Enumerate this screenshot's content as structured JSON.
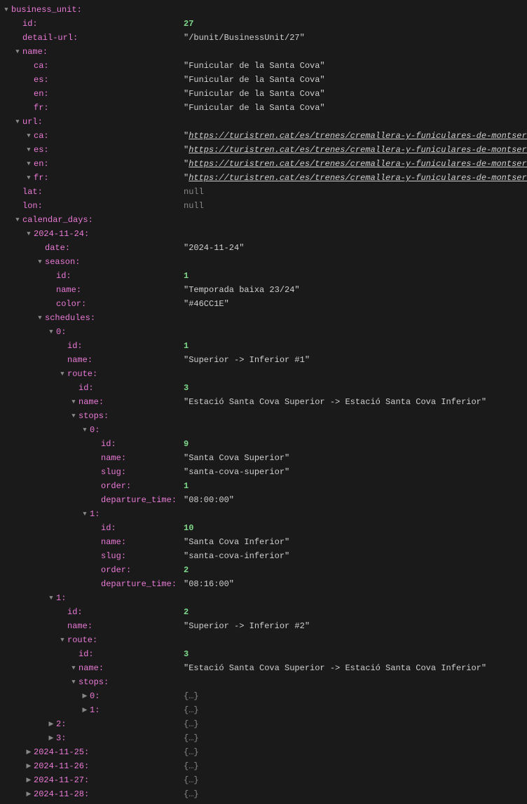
{
  "arrow_expanded": "▼",
  "arrow_collapsed": "▶",
  "collapsed_placeholder": "{…}",
  "rows": [
    {
      "indent": 0,
      "arrow": "expanded",
      "key": "business_unit",
      "vtype": "none"
    },
    {
      "indent": 1,
      "arrow": "none",
      "key": "id",
      "vtype": "num",
      "value": "27"
    },
    {
      "indent": 1,
      "arrow": "none",
      "key": "detail-url",
      "vtype": "str",
      "value": "/bunit/BusinessUnit/27"
    },
    {
      "indent": 1,
      "arrow": "expanded",
      "key": "name",
      "vtype": "none"
    },
    {
      "indent": 2,
      "arrow": "none",
      "key": "ca",
      "vtype": "str",
      "value": "Funicular de la Santa Cova"
    },
    {
      "indent": 2,
      "arrow": "none",
      "key": "es",
      "vtype": "str",
      "value": "Funicular de la Santa Cova"
    },
    {
      "indent": 2,
      "arrow": "none",
      "key": "en",
      "vtype": "str",
      "value": "Funicular de la Santa Cova"
    },
    {
      "indent": 2,
      "arrow": "none",
      "key": "fr",
      "vtype": "str",
      "value": "Funicular de la Santa Cova"
    },
    {
      "indent": 1,
      "arrow": "expanded",
      "key": "url",
      "vtype": "none"
    },
    {
      "indent": 2,
      "arrow": "expanded",
      "key": "ca",
      "vtype": "url",
      "value": "https://turistren.cat/es/trenes/cremallera-y-funiculares-de-montserrat/"
    },
    {
      "indent": 2,
      "arrow": "expanded",
      "key": "es",
      "vtype": "url",
      "value": "https://turistren.cat/es/trenes/cremallera-y-funiculares-de-montserrat/"
    },
    {
      "indent": 2,
      "arrow": "expanded",
      "key": "en",
      "vtype": "url",
      "value": "https://turistren.cat/es/trenes/cremallera-y-funiculares-de-montserrat/"
    },
    {
      "indent": 2,
      "arrow": "expanded",
      "key": "fr",
      "vtype": "url",
      "value": "https://turistren.cat/es/trenes/cremallera-y-funiculares-de-montserrat/"
    },
    {
      "indent": 1,
      "arrow": "none",
      "key": "lat",
      "vtype": "null",
      "value": "null"
    },
    {
      "indent": 1,
      "arrow": "none",
      "key": "lon",
      "vtype": "null",
      "value": "null"
    },
    {
      "indent": 1,
      "arrow": "expanded",
      "key": "calendar_days",
      "vtype": "none"
    },
    {
      "indent": 2,
      "arrow": "expanded",
      "key": "2024-11-24",
      "vtype": "none"
    },
    {
      "indent": 3,
      "arrow": "none",
      "key": "date",
      "vtype": "str",
      "value": "2024-11-24"
    },
    {
      "indent": 3,
      "arrow": "expanded",
      "key": "season",
      "vtype": "none"
    },
    {
      "indent": 4,
      "arrow": "none",
      "key": "id",
      "vtype": "num",
      "value": "1"
    },
    {
      "indent": 4,
      "arrow": "none",
      "key": "name",
      "vtype": "str",
      "value": "Temporada baixa 23/24"
    },
    {
      "indent": 4,
      "arrow": "none",
      "key": "color",
      "vtype": "str",
      "value": "#46CC1E"
    },
    {
      "indent": 3,
      "arrow": "expanded",
      "key": "schedules",
      "vtype": "none"
    },
    {
      "indent": 4,
      "arrow": "expanded",
      "key": "0",
      "vtype": "none"
    },
    {
      "indent": 5,
      "arrow": "none",
      "key": "id",
      "vtype": "num",
      "value": "1"
    },
    {
      "indent": 5,
      "arrow": "none",
      "key": "name",
      "vtype": "str",
      "value": "Superior -> Inferior #1"
    },
    {
      "indent": 5,
      "arrow": "expanded",
      "key": "route",
      "vtype": "none"
    },
    {
      "indent": 6,
      "arrow": "none",
      "key": "id",
      "vtype": "num",
      "value": "3"
    },
    {
      "indent": 6,
      "arrow": "expanded",
      "key": "name",
      "vtype": "str",
      "value": "Estació Santa Cova Superior -> Estació Santa Cova Inferior"
    },
    {
      "indent": 6,
      "arrow": "expanded",
      "key": "stops",
      "vtype": "none"
    },
    {
      "indent": 7,
      "arrow": "expanded",
      "key": "0",
      "vtype": "none"
    },
    {
      "indent": 8,
      "arrow": "none",
      "key": "id",
      "vtype": "num",
      "value": "9"
    },
    {
      "indent": 8,
      "arrow": "none",
      "key": "name",
      "vtype": "str",
      "value": "Santa Cova Superior"
    },
    {
      "indent": 8,
      "arrow": "none",
      "key": "slug",
      "vtype": "str",
      "value": "santa-cova-superior"
    },
    {
      "indent": 8,
      "arrow": "none",
      "key": "order",
      "vtype": "num",
      "value": "1"
    },
    {
      "indent": 8,
      "arrow": "none",
      "key": "departure_time",
      "vtype": "str",
      "value": "08:00:00"
    },
    {
      "indent": 7,
      "arrow": "expanded",
      "key": "1",
      "vtype": "none"
    },
    {
      "indent": 8,
      "arrow": "none",
      "key": "id",
      "vtype": "num",
      "value": "10"
    },
    {
      "indent": 8,
      "arrow": "none",
      "key": "name",
      "vtype": "str",
      "value": "Santa Cova Inferior"
    },
    {
      "indent": 8,
      "arrow": "none",
      "key": "slug",
      "vtype": "str",
      "value": "santa-cova-inferior"
    },
    {
      "indent": 8,
      "arrow": "none",
      "key": "order",
      "vtype": "num",
      "value": "2"
    },
    {
      "indent": 8,
      "arrow": "none",
      "key": "departure_time",
      "vtype": "str",
      "value": "08:16:00"
    },
    {
      "indent": 4,
      "arrow": "expanded",
      "key": "1",
      "vtype": "none"
    },
    {
      "indent": 5,
      "arrow": "none",
      "key": "id",
      "vtype": "num",
      "value": "2"
    },
    {
      "indent": 5,
      "arrow": "none",
      "key": "name",
      "vtype": "str",
      "value": "Superior -> Inferior #2"
    },
    {
      "indent": 5,
      "arrow": "expanded",
      "key": "route",
      "vtype": "none"
    },
    {
      "indent": 6,
      "arrow": "none",
      "key": "id",
      "vtype": "num",
      "value": "3"
    },
    {
      "indent": 6,
      "arrow": "expanded",
      "key": "name",
      "vtype": "str",
      "value": "Estació Santa Cova Superior -> Estació Santa Cova Inferior"
    },
    {
      "indent": 6,
      "arrow": "expanded",
      "key": "stops",
      "vtype": "none"
    },
    {
      "indent": 7,
      "arrow": "collapsed",
      "key": "0",
      "vtype": "collapsed"
    },
    {
      "indent": 7,
      "arrow": "collapsed",
      "key": "1",
      "vtype": "collapsed"
    },
    {
      "indent": 4,
      "arrow": "collapsed",
      "key": "2",
      "vtype": "collapsed"
    },
    {
      "indent": 4,
      "arrow": "collapsed",
      "key": "3",
      "vtype": "collapsed"
    },
    {
      "indent": 2,
      "arrow": "collapsed",
      "key": "2024-11-25",
      "vtype": "collapsed"
    },
    {
      "indent": 2,
      "arrow": "collapsed",
      "key": "2024-11-26",
      "vtype": "collapsed"
    },
    {
      "indent": 2,
      "arrow": "collapsed",
      "key": "2024-11-27",
      "vtype": "collapsed"
    },
    {
      "indent": 2,
      "arrow": "collapsed",
      "key": "2024-11-28",
      "vtype": "collapsed"
    }
  ]
}
